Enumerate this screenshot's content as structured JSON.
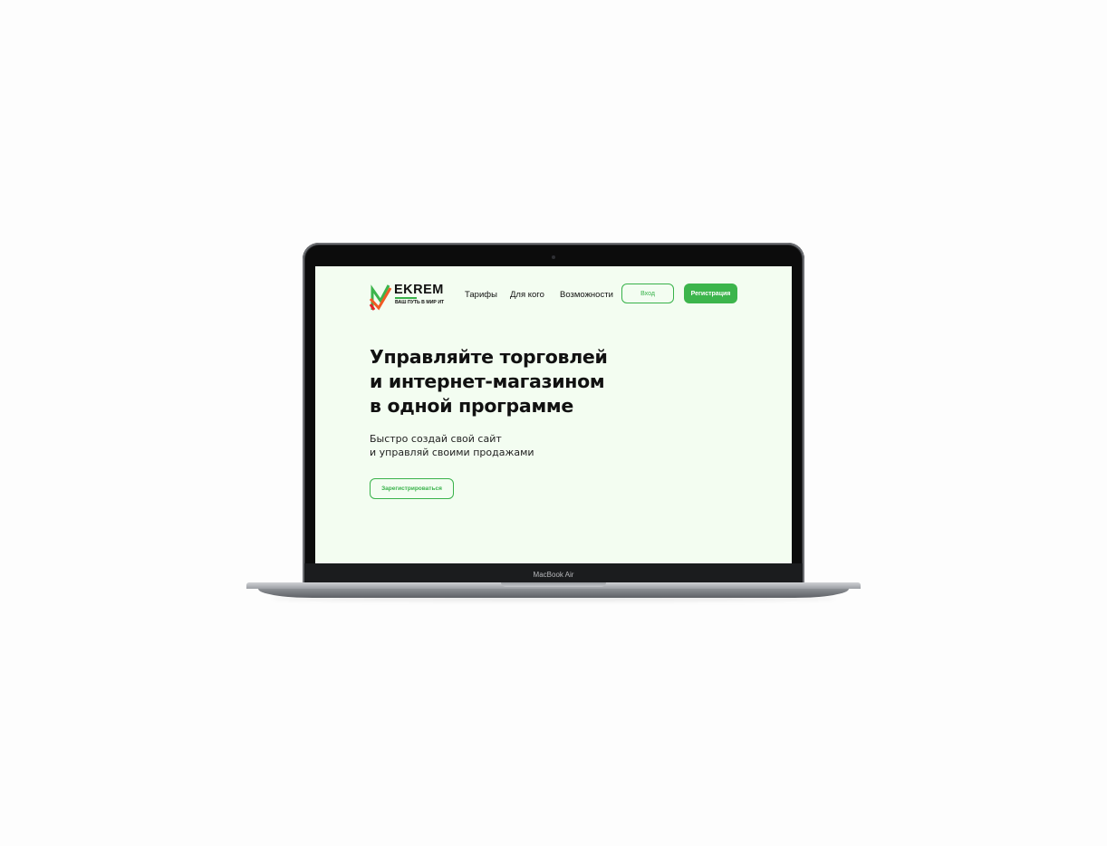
{
  "device": {
    "label": "MacBook Air"
  },
  "site": {
    "logo": {
      "name": "EKREM",
      "tagline": "ВАШ ПУТЬ В МИР ИТ"
    },
    "nav": {
      "items": [
        {
          "label": "Тарифы"
        },
        {
          "label": "Для кого"
        },
        {
          "label": "Возможности"
        }
      ],
      "login_label": "Вход",
      "register_label": "Регистрация"
    },
    "hero": {
      "title_lines": [
        "Управляйте торговлей",
        "и интернет-магазином",
        "в одной программе"
      ],
      "subtitle_lines": [
        "Быстро создай свой сайт",
        "и управляй своими продажами"
      ],
      "cta_label": "Зарегистрироваться"
    }
  },
  "colors": {
    "accent": "#3cb54c",
    "screen_background": "#f3fdf1",
    "text": "#111111"
  }
}
